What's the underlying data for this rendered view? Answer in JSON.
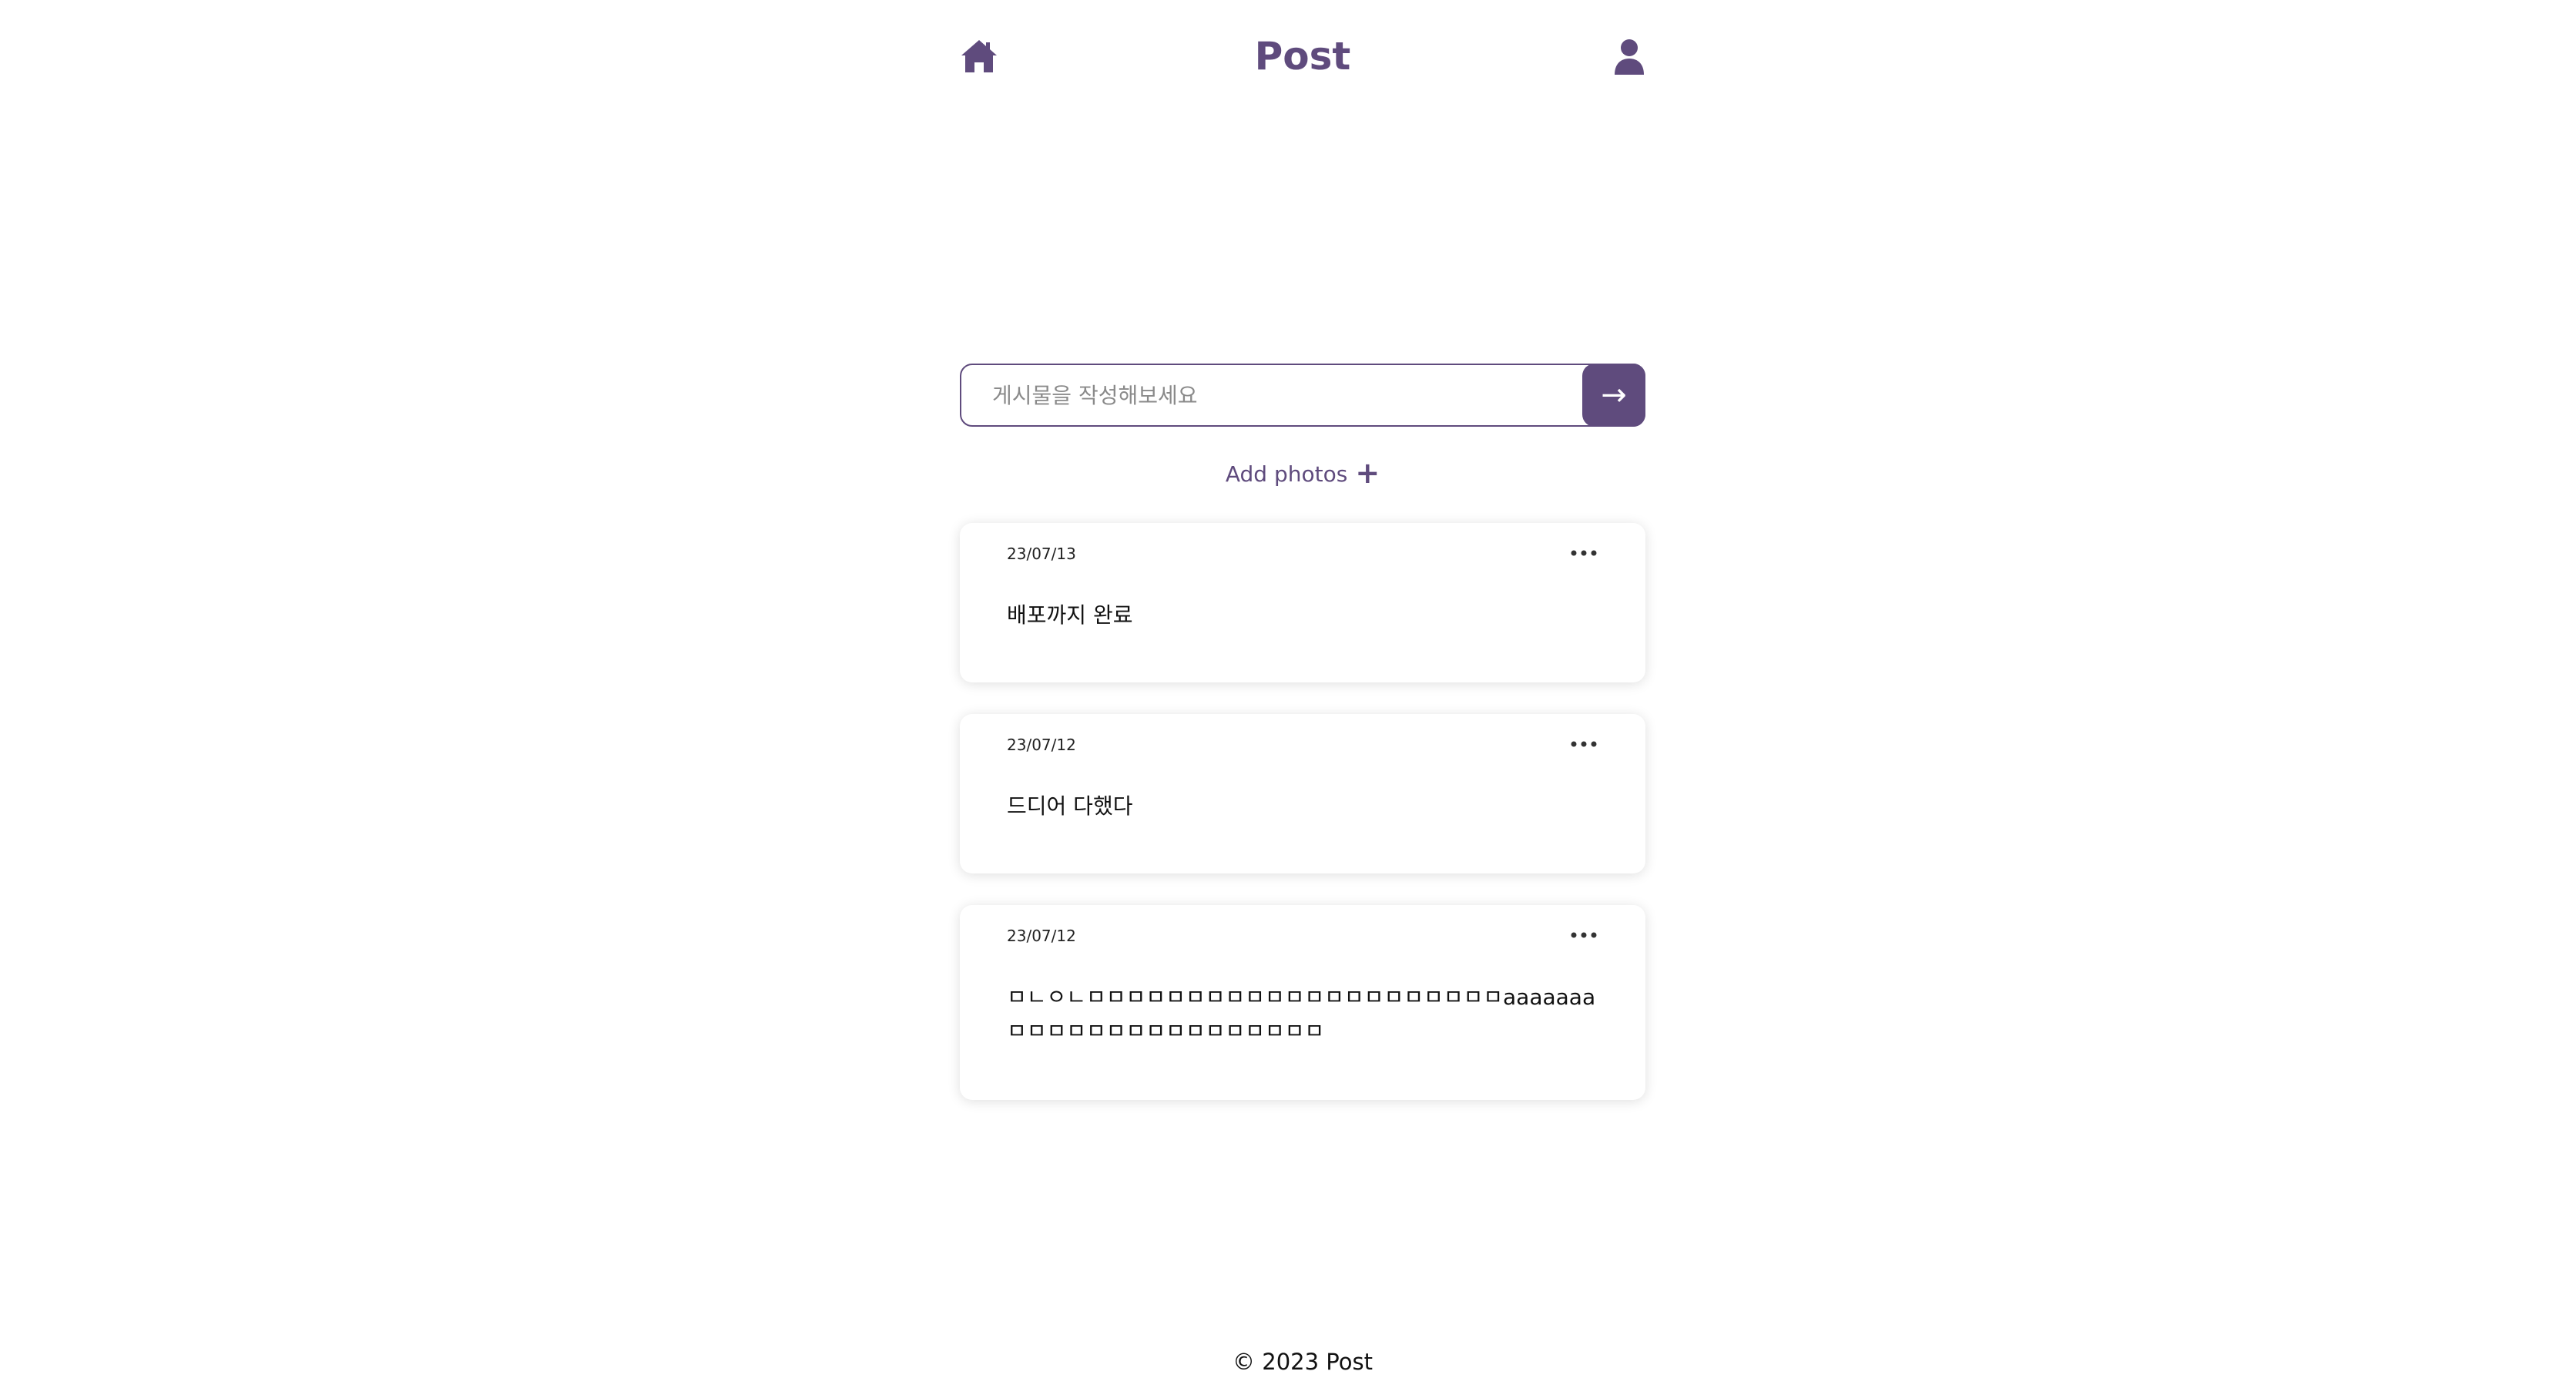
{
  "header": {
    "title": "Post",
    "home_icon": "home-icon",
    "user_icon": "user-icon"
  },
  "composer": {
    "placeholder": "게시물을 작성해보세요",
    "value": "",
    "submit_label": "→"
  },
  "add_photos": {
    "label": "Add photos",
    "icon": "+"
  },
  "posts": [
    {
      "date": "23/07/13",
      "content": "배포까지 완료"
    },
    {
      "date": "23/07/12",
      "content": "드디어 다했다"
    },
    {
      "date": "23/07/12",
      "content": "ㅁㄴㅇㄴㅁㅁㅁㅁㅁㅁㅁㅁㅁㅁㅁㅁㅁㅁㅁㅁㅁㅁㅁㅁㅁaaaaaaaㅁㅁㅁㅁㅁㅁㅁㅁㅁㅁㅁㅁㅁㅁㅁㅁ"
    }
  ],
  "footer": {
    "text": "© 2023 Post"
  },
  "colors": {
    "accent": "#5f4b7d",
    "background": "#ffffff"
  }
}
